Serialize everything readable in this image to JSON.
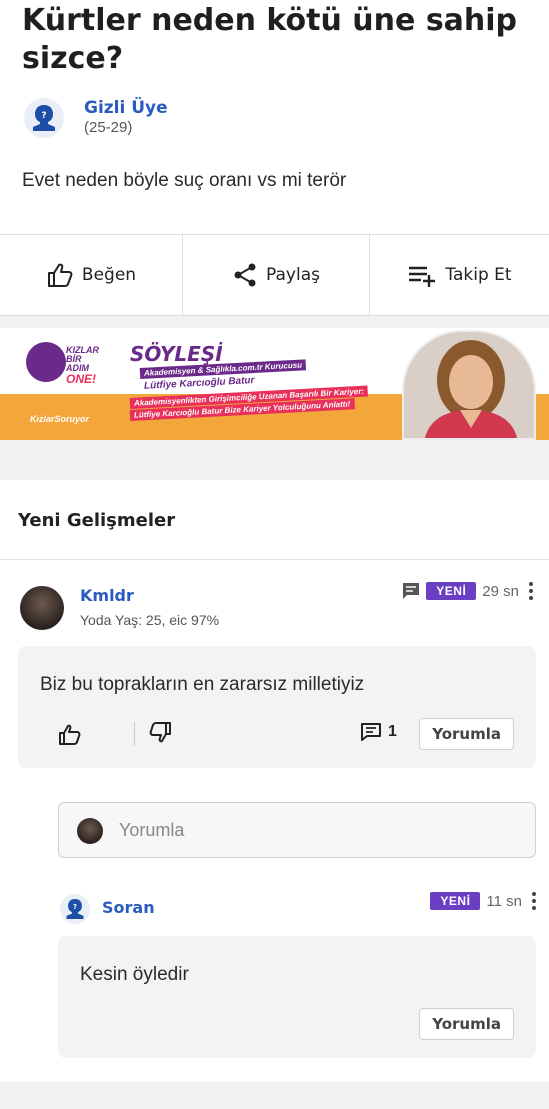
{
  "question": {
    "title": "Kürtler neden kötü üne sahip sizce?",
    "asker_name": "Gizli Üye",
    "asker_age": "(25-29)",
    "body": "Evet neden böyle suç oranı vs mi terör"
  },
  "actions": {
    "like": "Beğen",
    "share": "Paylaş",
    "follow": "Takip Et"
  },
  "banner": {
    "brand_line1": "KIZLAR",
    "brand_line2": "BİR ADIM",
    "brand_line3": "ONE!",
    "site": "KızlarSoruyor",
    "heading": "SÖYLEŞİ",
    "line1": "Akademisyen & Sağlıkla.com.tr Kurucusu",
    "line2": "Lütfiye Karcıoğlu Batur",
    "line3": "Akademisyenlikten Girişimciliğe Uzanan Başarılı Bir Kariyer:",
    "line4": "Lütfiye Karcıoğlu Batur Bize Kariyer Yolculuğunu Anlattı!"
  },
  "section": {
    "title": "Yeni Gelişmeler"
  },
  "post": {
    "author": "Kmldr",
    "meta": "Yoda Yaş: 25, eic 97%",
    "badge": "YENİ",
    "time": "29 sn",
    "text": "Biz bu toprakların en zararsız milletiyiz",
    "comment_count": "1",
    "reply_button": "Yorumla"
  },
  "reply_input": {
    "placeholder": "Yorumla"
  },
  "reply": {
    "author": "Soran",
    "badge": "YENİ",
    "time": "11 sn",
    "text": "Kesin öyledir",
    "reply_button": "Yorumla"
  },
  "colors": {
    "link_blue": "#2a5bbf",
    "badge_purple": "#6a3fc4",
    "banner_orange": "#f3a63a",
    "banner_purple": "#6b2a8a"
  }
}
